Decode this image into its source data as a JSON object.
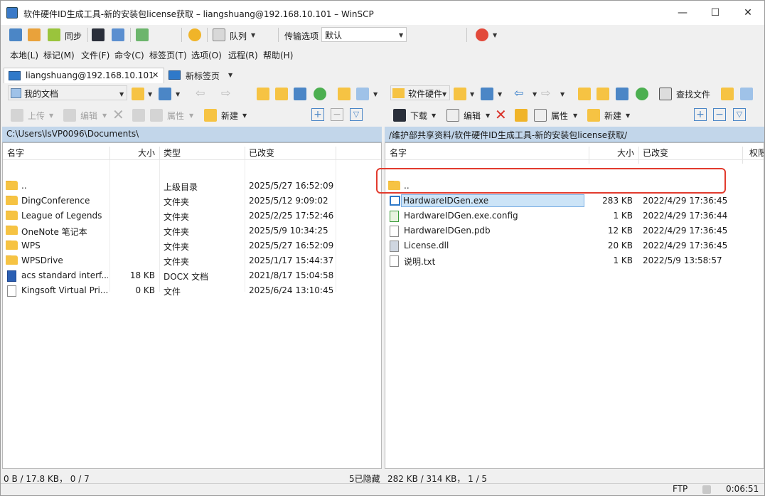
{
  "window": {
    "title": "软件硬件ID生成工具-新的安装包license获取 – liangshuang@192.168.10.101 – WinSCP",
    "minimize": "—",
    "maximize": "☐",
    "close": "✕"
  },
  "toolbar": {
    "sync_label": "同步",
    "queue_label": "队列",
    "transfer_label": "传输选项",
    "transfer_value": "默认"
  },
  "menu": [
    "本地(L)",
    "标记(M)",
    "文件(F)",
    "命令(C)",
    "标签页(T)",
    "选项(O)",
    "远程(R)",
    "帮助(H)"
  ],
  "tabs": [
    {
      "label": "liangshuang@192.168.10.101",
      "close": "✕"
    },
    {
      "label": "新标签页"
    }
  ],
  "left": {
    "location": "我的文档",
    "actions": {
      "upload": "上传",
      "edit": "编辑",
      "props": "属性",
      "new": "新建"
    },
    "path": "C:\\Users\\lsVP0096\\Documents\\",
    "columns": {
      "name": "名字",
      "size": "大小",
      "type": "类型",
      "changed": "已改变"
    },
    "rows": [
      {
        "name": "..",
        "size": "",
        "type": "上级目录",
        "changed": "2025/5/27 16:52:09",
        "icon": "up-folder"
      },
      {
        "name": "DingConference",
        "size": "",
        "type": "文件夹",
        "changed": "2025/5/12 9:09:02",
        "icon": "folder"
      },
      {
        "name": "League of Legends",
        "size": "",
        "type": "文件夹",
        "changed": "2025/2/25 17:52:46",
        "icon": "folder"
      },
      {
        "name": "OneNote 笔记本",
        "size": "",
        "type": "文件夹",
        "changed": "2025/5/9 10:34:25",
        "icon": "folder"
      },
      {
        "name": "WPS",
        "size": "",
        "type": "文件夹",
        "changed": "2025/5/27 16:52:09",
        "icon": "folder"
      },
      {
        "name": "WPSDrive",
        "size": "",
        "type": "文件夹",
        "changed": "2025/1/17 15:44:37",
        "icon": "folder"
      },
      {
        "name": "acs standard interf...",
        "size": "18 KB",
        "type": "DOCX 文档",
        "changed": "2021/8/17 15:04:58",
        "icon": "word"
      },
      {
        "name": "Kingsoft Virtual Pri...",
        "size": "0 KB",
        "type": "文件",
        "changed": "2025/6/24 13:10:45",
        "icon": "file"
      }
    ],
    "status": "0 B / 17.8 KB， 0 / 7",
    "hidden": "5已隐藏"
  },
  "right": {
    "location": "软件硬件",
    "actions": {
      "download": "下载",
      "edit": "编辑",
      "props": "属性",
      "new": "新建",
      "find": "查找文件"
    },
    "path": "/维护部共享资料/软件硬件ID生成工具-新的安装包license获取/",
    "columns": {
      "name": "名字",
      "size": "大小",
      "changed": "已改变",
      "rights": "权限"
    },
    "rows": [
      {
        "name": "..",
        "size": "",
        "changed": "",
        "icon": "up-folder"
      },
      {
        "name": "HardwareIDGen.exe",
        "size": "283 KB",
        "changed": "2022/4/29 17:36:45",
        "icon": "exe",
        "selected": true
      },
      {
        "name": "HardwareIDGen.exe.config",
        "size": "1 KB",
        "changed": "2022/4/29 17:36:44",
        "icon": "config"
      },
      {
        "name": "HardwareIDGen.pdb",
        "size": "12 KB",
        "changed": "2022/4/29 17:36:45",
        "icon": "file"
      },
      {
        "name": "License.dll",
        "size": "20 KB",
        "changed": "2022/4/29 17:36:45",
        "icon": "dll"
      },
      {
        "name": "说明.txt",
        "size": "1 KB",
        "changed": "2022/5/9 13:58:57",
        "icon": "txt"
      }
    ],
    "status": "282 KB / 314 KB， 1 / 5"
  },
  "statusbar": {
    "protocol": "FTP",
    "time": "0:06:51"
  },
  "colors": {
    "highlight": "#e23b2e",
    "path_bg": "#c2d6ea",
    "selection": "#cce4f7"
  }
}
